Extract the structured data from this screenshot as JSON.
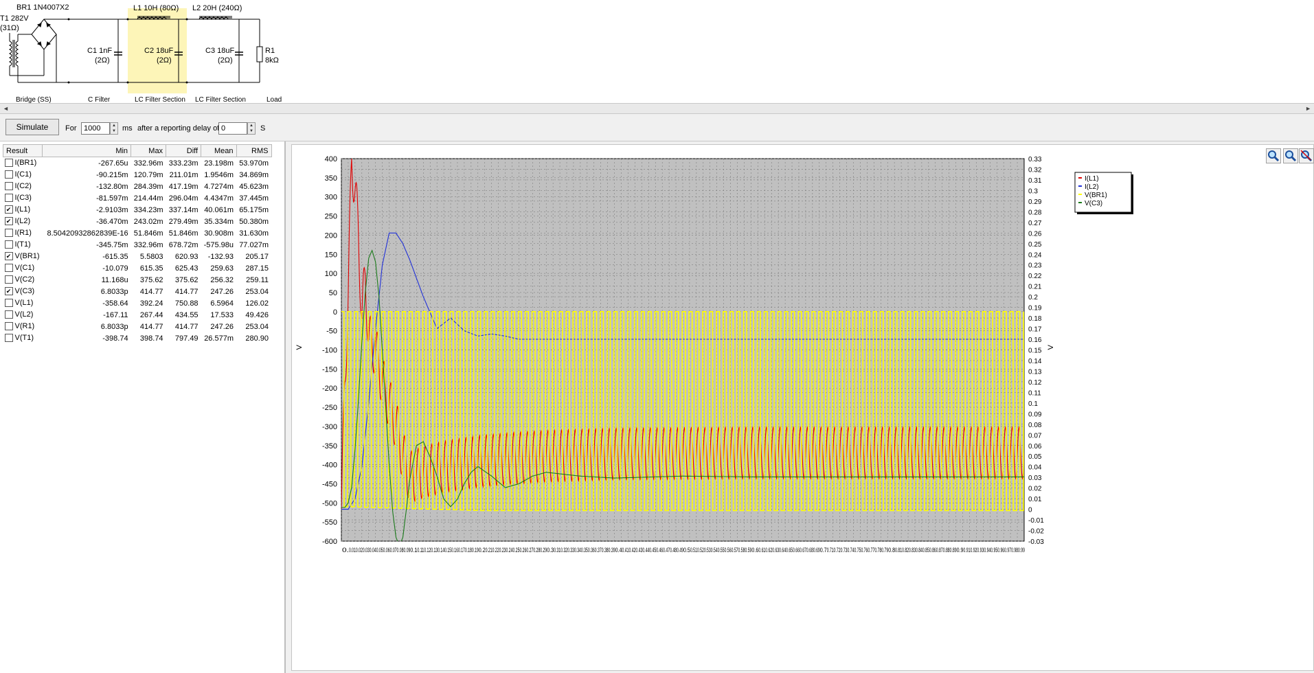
{
  "schematic": {
    "t1": {
      "label": "T1 282V",
      "resistance": "(31Ω)"
    },
    "br1": {
      "label": "BR1 1N4007X2"
    },
    "l1": {
      "label": "L1 10H (80Ω)"
    },
    "l2": {
      "label": "L2 20H (240Ω)"
    },
    "c1": {
      "label": "C1 1nF",
      "resistance": "(2Ω)"
    },
    "c2": {
      "label": "C2 18uF",
      "resistance": "(2Ω)"
    },
    "c3": {
      "label": "C3 18uF",
      "resistance": "(2Ω)"
    },
    "r1": {
      "label": "R1",
      "value": "8kΩ"
    },
    "sections": [
      "Bridge (SS)",
      "C Filter",
      "LC Filter Section",
      "LC Filter Section",
      "Load"
    ],
    "highlight_color": "#fdf5b8"
  },
  "toolbar": {
    "simulate_label": "Simulate",
    "for_label": "For",
    "duration_value": "1000",
    "ms_label": "ms",
    "delay_label": "after a reporting delay of",
    "delay_value": "0",
    "s_label": "S",
    "spin_up": "▲",
    "spin_down": "▼"
  },
  "scroll": {
    "left_arrow": "◄",
    "right_arrow": "►"
  },
  "results": {
    "headers": [
      "Result",
      "Min",
      "Max",
      "Diff",
      "Mean",
      "RMS"
    ],
    "rows": [
      {
        "name": "I(BR1)",
        "checked": false,
        "min": "-267.65u",
        "max": "332.96m",
        "diff": "333.23m",
        "mean": "23.198m",
        "rms": "53.970m"
      },
      {
        "name": "I(C1)",
        "checked": false,
        "min": "-90.215m",
        "max": "120.79m",
        "diff": "211.01m",
        "mean": "1.9546m",
        "rms": "34.869m"
      },
      {
        "name": "I(C2)",
        "checked": false,
        "min": "-132.80m",
        "max": "284.39m",
        "diff": "417.19m",
        "mean": "4.7274m",
        "rms": "45.623m"
      },
      {
        "name": "I(C3)",
        "checked": false,
        "min": "-81.597m",
        "max": "214.44m",
        "diff": "296.04m",
        "mean": "4.4347m",
        "rms": "37.445m"
      },
      {
        "name": "I(L1)",
        "checked": true,
        "min": "-2.9103m",
        "max": "334.23m",
        "diff": "337.14m",
        "mean": "40.061m",
        "rms": "65.175m"
      },
      {
        "name": "I(L2)",
        "checked": true,
        "min": "-36.470m",
        "max": "243.02m",
        "diff": "279.49m",
        "mean": "35.334m",
        "rms": "50.380m"
      },
      {
        "name": "I(R1)",
        "checked": false,
        "min": "8.50420932862839E-16",
        "max": "51.846m",
        "diff": "51.846m",
        "mean": "30.908m",
        "rms": "31.630m"
      },
      {
        "name": "I(T1)",
        "checked": false,
        "min": "-345.75m",
        "max": "332.96m",
        "diff": "678.72m",
        "mean": "-575.98u",
        "rms": "77.027m"
      },
      {
        "name": "V(BR1)",
        "checked": true,
        "min": "-615.35",
        "max": "5.5803",
        "diff": "620.93",
        "mean": "-132.93",
        "rms": "205.17"
      },
      {
        "name": "V(C1)",
        "checked": false,
        "min": "-10.079",
        "max": "615.35",
        "diff": "625.43",
        "mean": "259.63",
        "rms": "287.15"
      },
      {
        "name": "V(C2)",
        "checked": false,
        "min": "11.168u",
        "max": "375.62",
        "diff": "375.62",
        "mean": "256.32",
        "rms": "259.11"
      },
      {
        "name": "V(C3)",
        "checked": true,
        "min": "6.8033p",
        "max": "414.77",
        "diff": "414.77",
        "mean": "247.26",
        "rms": "253.04"
      },
      {
        "name": "V(L1)",
        "checked": false,
        "min": "-358.64",
        "max": "392.24",
        "diff": "750.88",
        "mean": "6.5964",
        "rms": "126.02"
      },
      {
        "name": "V(L2)",
        "checked": false,
        "min": "-167.11",
        "max": "267.44",
        "diff": "434.55",
        "mean": "17.533",
        "rms": "49.426"
      },
      {
        "name": "V(R1)",
        "checked": false,
        "min": "6.8033p",
        "max": "414.77",
        "diff": "414.77",
        "mean": "247.26",
        "rms": "253.04"
      },
      {
        "name": "V(T1)",
        "checked": false,
        "min": "-398.74",
        "max": "398.74",
        "diff": "797.49",
        "mean": "26.577m",
        "rms": "280.90"
      }
    ]
  },
  "zoom": {
    "icons": [
      "zoom-in-icon",
      "zoom-out-icon",
      "zoom-reset-icon"
    ]
  },
  "chart_data": {
    "type": "line",
    "ylabel_left": "V",
    "ylabel_right": "V",
    "ylim_left": [
      -600,
      400
    ],
    "ylim_right": [
      -0.03,
      0.33
    ],
    "xlim": [
      0,
      1
    ],
    "y_ticks_left": [
      "400",
      "350",
      "300",
      "250",
      "200",
      "150",
      "100",
      "50",
      "0",
      "-50",
      "-100",
      "-150",
      "-200",
      "-250",
      "-300",
      "-350",
      "-400",
      "-450",
      "-500",
      "-550",
      "-600"
    ],
    "y_ticks_right": [
      "0.33",
      "0.32",
      "0.31",
      "0.3",
      "0.29",
      "0.28",
      "0.27",
      "0.26",
      "0.25",
      "0.24",
      "0.23",
      "0.22",
      "0.21",
      "0.2",
      "0.19",
      "0.18",
      "0.17",
      "0.16",
      "0.15",
      "0.14",
      "0.13",
      "0.12",
      "0.11",
      "0.1",
      "0.09",
      "0.08",
      "0.07",
      "0.06",
      "0.05",
      "0.04",
      "0.03",
      "0.02",
      "0.01",
      "0",
      "-0.01",
      "-0.02",
      "-0.03"
    ],
    "x_ticks": [
      "0.",
      "0.01",
      "0.02",
      "0.03",
      "0.04",
      "0.05",
      "0.06",
      "0.07",
      "0.08",
      "0.09",
      "0.1",
      "0.11",
      "0.12",
      "0.13",
      "0.14",
      "0.15",
      "0.16",
      "0.17",
      "0.18",
      "0.19",
      "0.2",
      "0.21",
      "0.22",
      "0.23",
      "0.24",
      "0.25",
      "0.26",
      "0.27",
      "0.28",
      "0.29",
      "0.3",
      "0.31",
      "0.32",
      "0.33",
      "0.34",
      "0.35",
      "0.36",
      "0.37",
      "0.38",
      "0.39",
      "0.4",
      "0.41",
      "0.42",
      "0.43",
      "0.44",
      "0.45",
      "0.46",
      "0.47",
      "0.48",
      "0.49",
      "0.5",
      "0.51",
      "0.52",
      "0.53",
      "0.54",
      "0.55",
      "0.56",
      "0.57",
      "0.58",
      "0.59",
      "0.6",
      "0.61",
      "0.62",
      "0.63",
      "0.64",
      "0.65",
      "0.66",
      "0.67",
      "0.68",
      "0.69",
      "0.7",
      "0.71",
      "0.72",
      "0.73",
      "0.74",
      "0.75",
      "0.76",
      "0.77",
      "0.78",
      "0.79",
      "0.8",
      "0.81",
      "0.82",
      "0.83",
      "0.84",
      "0.85",
      "0.86",
      "0.87",
      "0.88",
      "0.89",
      "0.9",
      "0.91",
      "0.92",
      "0.93",
      "0.94",
      "0.95",
      "0.96",
      "0.97",
      "0.98",
      "0.99"
    ],
    "grid": true,
    "legend_position": "top-right",
    "series": [
      {
        "name": "I(L1)",
        "axis": "right",
        "color": "#e00000",
        "x": [
          0,
          0.005,
          0.01,
          0.015,
          0.02,
          0.025,
          0.03,
          0.035,
          0.04,
          0.05,
          0.06,
          0.07,
          0.08,
          0.09,
          0.1,
          0.12,
          0.15,
          0.2,
          0.25,
          0.3,
          0.4,
          0.6,
          0.8,
          1.0
        ],
        "y": [
          0,
          0.12,
          0.2,
          0.33,
          0.3,
          0.26,
          0.18,
          0.22,
          0.16,
          0.15,
          0.12,
          0.1,
          0.08,
          0.05,
          0.03,
          0.035,
          0.04,
          0.045,
          0.048,
          0.05,
          0.052,
          0.053,
          0.053,
          0.053
        ],
        "ripple_pp": 0.048
      },
      {
        "name": "I(L2)",
        "axis": "right",
        "color": "#2030d8",
        "x": [
          0,
          0.01,
          0.02,
          0.03,
          0.04,
          0.05,
          0.06,
          0.07,
          0.08,
          0.09,
          0.1,
          0.12,
          0.14,
          0.16,
          0.18,
          0.2,
          0.22,
          0.24,
          0.26,
          0.28,
          0.3,
          0.35,
          0.4,
          0.5,
          0.7,
          1.0
        ],
        "y": [
          0,
          0,
          0.01,
          0.04,
          0.1,
          0.17,
          0.23,
          0.26,
          0.26,
          0.25,
          0.235,
          0.2,
          0.17,
          0.18,
          0.168,
          0.163,
          0.165,
          0.163,
          0.16,
          0.16,
          0.16,
          0.16,
          0.16,
          0.16,
          0.16,
          0.16
        ]
      },
      {
        "name": "V(BR1)",
        "axis": "left",
        "color": "#ffff00",
        "low_start": -510,
        "low_floor": -520,
        "high": 0,
        "period": 0.01
      },
      {
        "name": "V(C3)",
        "axis": "left",
        "color": "#1a7a1a",
        "x": [
          0,
          0.005,
          0.01,
          0.015,
          0.02,
          0.025,
          0.03,
          0.035,
          0.04,
          0.045,
          0.05,
          0.055,
          0.06,
          0.065,
          0.07,
          0.075,
          0.08,
          0.085,
          0.09,
          0.095,
          0.1,
          0.11,
          0.12,
          0.13,
          0.14,
          0.15,
          0.16,
          0.17,
          0.18,
          0.19,
          0.2,
          0.22,
          0.24,
          0.26,
          0.28,
          0.3,
          0.35,
          0.4,
          0.5,
          0.6,
          0.8,
          1.0
        ],
        "y": [
          -512,
          -512,
          -500,
          -460,
          -360,
          -230,
          -80,
          50,
          140,
          160,
          130,
          40,
          -100,
          -250,
          -400,
          -520,
          -590,
          -612,
          -590,
          -520,
          -440,
          -350,
          -340,
          -380,
          -430,
          -490,
          -510,
          -490,
          -450,
          -420,
          -405,
          -430,
          -460,
          -450,
          -430,
          -420,
          -430,
          -435,
          -430,
          -432,
          -432,
          -432
        ]
      }
    ]
  }
}
